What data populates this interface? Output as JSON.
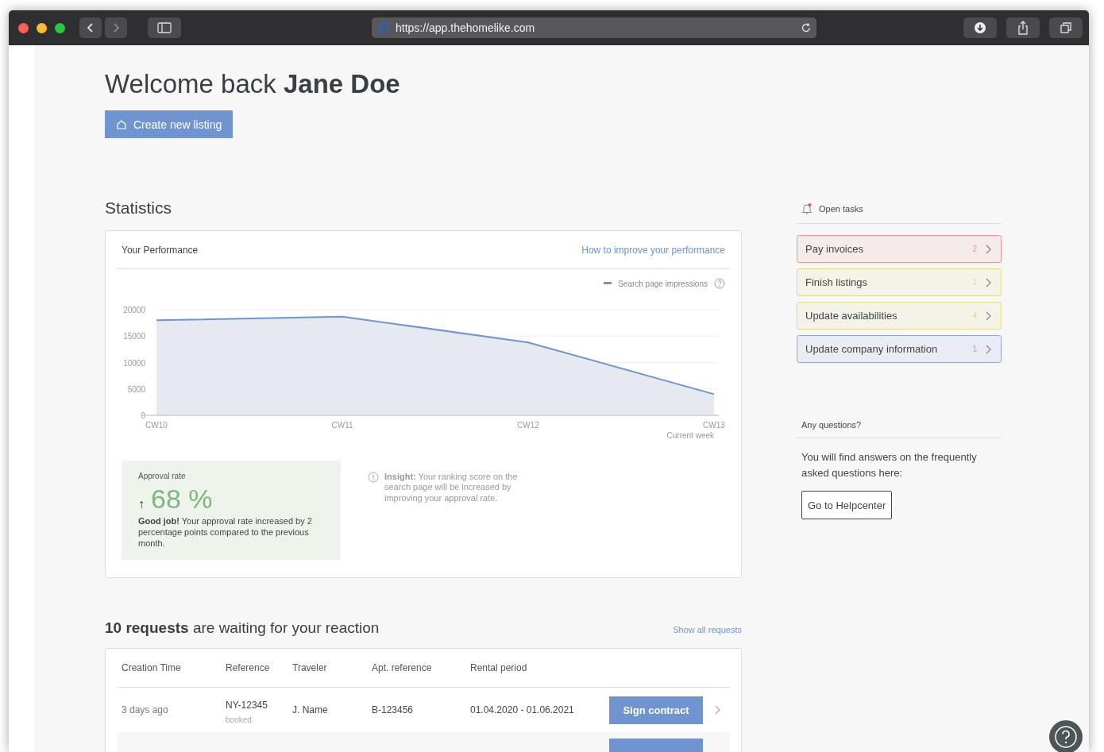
{
  "browser": {
    "url": "https://app.thehomelike.com"
  },
  "welcome": {
    "greeting": "Welcome back",
    "name": "Jane Doe"
  },
  "create_button": {
    "label": "Create new listing"
  },
  "statistics": {
    "title": "Statistics",
    "performance": {
      "title": "Your Performance",
      "link": "How to improve your performance",
      "current_week_note": "Current week",
      "chart_data": {
        "type": "area",
        "categories": [
          "CW10",
          "CW11",
          "CW12",
          "CW13"
        ],
        "grid": true,
        "series": [
          {
            "name": "Search page impressions",
            "color": "#6f94cf",
            "values": [
              18000,
              18700,
              13800,
              4000
            ]
          }
        ],
        "ylim": [
          0,
          20000
        ],
        "yticks": [
          0,
          5000,
          10000,
          15000,
          20000
        ]
      }
    },
    "approval": {
      "title": "Approval rate",
      "arrow": "↑",
      "value": "68 %",
      "text": "**Good job!** Your approval rate increased by 2 percentage points compared to the previous month."
    },
    "insight": {
      "text": "**Insight:** Your ranking score on the search page will be increased by improving your approval rate."
    }
  },
  "requests": {
    "title": "**10 requests** are waiting for your reaction",
    "link": "Show all requests",
    "columns": [
      "Creation Time",
      "Reference",
      "Traveler",
      "Apt. reference",
      "Rental period"
    ],
    "rows": [
      {
        "created": "3 days ago",
        "reference": "NY-12345",
        "status": "booked",
        "traveler": "J. Name",
        "apt_reference": "B-123456",
        "period": "01.04.2020 - 01.06.2021",
        "action": "Sign contract"
      }
    ]
  },
  "open_tasks": {
    "title": "Open tasks",
    "items": [
      {
        "label": "Pay invoices",
        "count": "2",
        "color": "#e79a9a"
      },
      {
        "label": "Finish listings",
        "count": "1",
        "color": "#e3d98a"
      },
      {
        "label": "Update availabilities",
        "count": "4",
        "color": "#e3d98a"
      },
      {
        "label": "Update company information",
        "count": "1",
        "color": "#8eaad6"
      }
    ]
  },
  "questions": {
    "title": "Any questions?",
    "text": "You will find answers on the frequently asked questions here:",
    "button": "Go to Helpcenter"
  }
}
